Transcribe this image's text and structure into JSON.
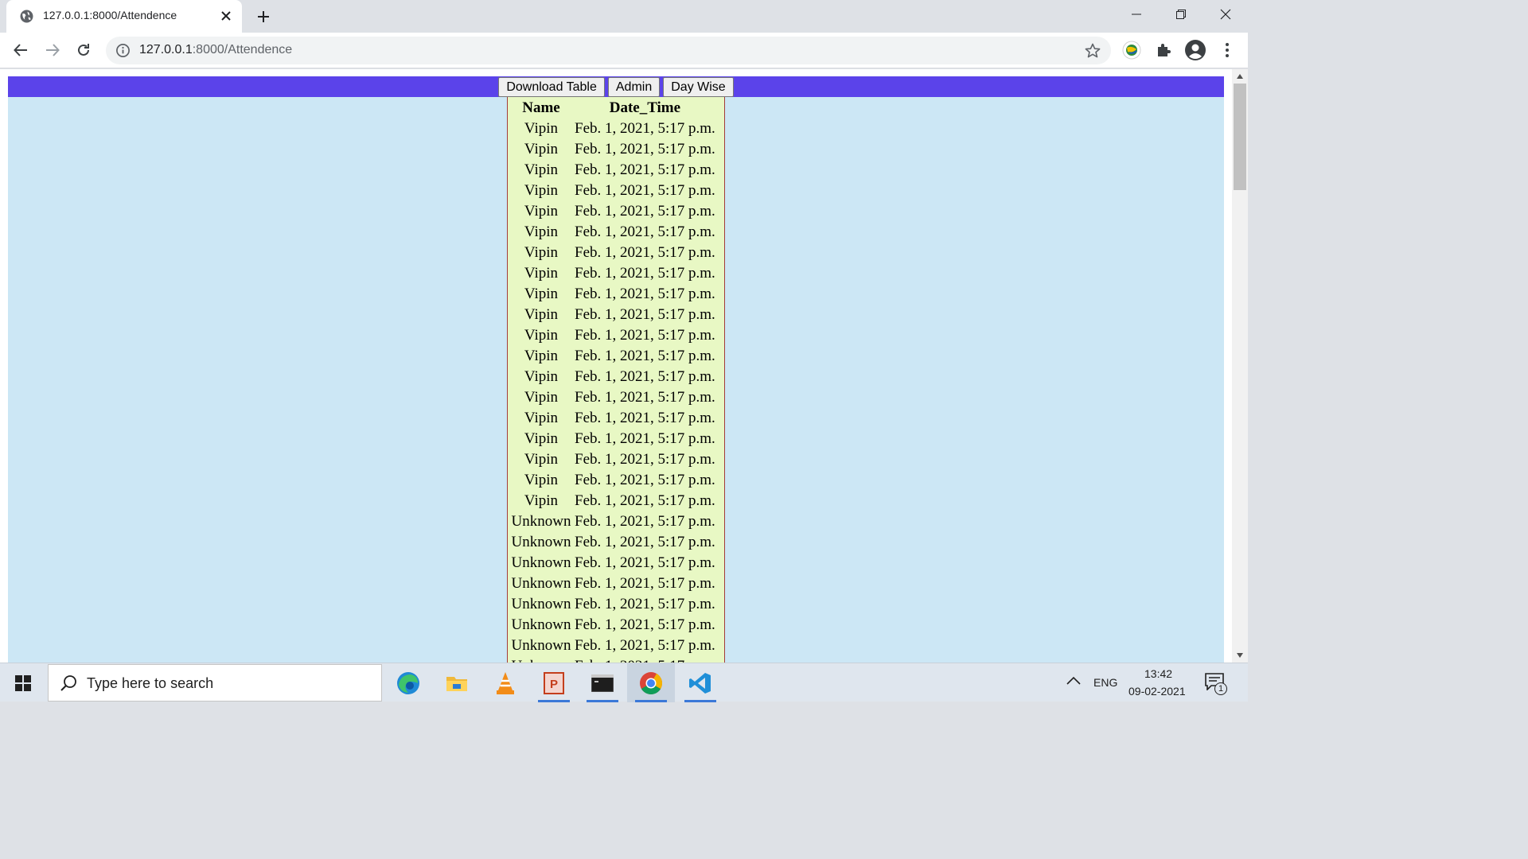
{
  "browser": {
    "tab_title": "127.0.0.1:8000/Attendence",
    "url_host": "127.0.0.1",
    "url_path": ":8000/Attendence"
  },
  "page": {
    "nav_buttons": [
      "Download Table",
      "Admin",
      "Day Wise"
    ],
    "table": {
      "headers": [
        "Name",
        "Date_Time"
      ],
      "rows": [
        [
          "Vipin",
          "Feb. 1, 2021, 5:17 p.m."
        ],
        [
          "Vipin",
          "Feb. 1, 2021, 5:17 p.m."
        ],
        [
          "Vipin",
          "Feb. 1, 2021, 5:17 p.m."
        ],
        [
          "Vipin",
          "Feb. 1, 2021, 5:17 p.m."
        ],
        [
          "Vipin",
          "Feb. 1, 2021, 5:17 p.m."
        ],
        [
          "Vipin",
          "Feb. 1, 2021, 5:17 p.m."
        ],
        [
          "Vipin",
          "Feb. 1, 2021, 5:17 p.m."
        ],
        [
          "Vipin",
          "Feb. 1, 2021, 5:17 p.m."
        ],
        [
          "Vipin",
          "Feb. 1, 2021, 5:17 p.m."
        ],
        [
          "Vipin",
          "Feb. 1, 2021, 5:17 p.m."
        ],
        [
          "Vipin",
          "Feb. 1, 2021, 5:17 p.m."
        ],
        [
          "Vipin",
          "Feb. 1, 2021, 5:17 p.m."
        ],
        [
          "Vipin",
          "Feb. 1, 2021, 5:17 p.m."
        ],
        [
          "Vipin",
          "Feb. 1, 2021, 5:17 p.m."
        ],
        [
          "Vipin",
          "Feb. 1, 2021, 5:17 p.m."
        ],
        [
          "Vipin",
          "Feb. 1, 2021, 5:17 p.m."
        ],
        [
          "Vipin",
          "Feb. 1, 2021, 5:17 p.m."
        ],
        [
          "Vipin",
          "Feb. 1, 2021, 5:17 p.m."
        ],
        [
          "Vipin",
          "Feb. 1, 2021, 5:17 p.m."
        ],
        [
          "Unknown",
          "Feb. 1, 2021, 5:17 p.m."
        ],
        [
          "Unknown",
          "Feb. 1, 2021, 5:17 p.m."
        ],
        [
          "Unknown",
          "Feb. 1, 2021, 5:17 p.m."
        ],
        [
          "Unknown",
          "Feb. 1, 2021, 5:17 p.m."
        ],
        [
          "Unknown",
          "Feb. 1, 2021, 5:17 p.m."
        ],
        [
          "Unknown",
          "Feb. 1, 2021, 5:17 p.m."
        ],
        [
          "Unknown",
          "Feb. 1, 2021, 5:17 p.m."
        ],
        [
          "Unknown",
          "Feb. 1, 2021, 5:17 p.m."
        ]
      ]
    }
  },
  "taskbar": {
    "search_placeholder": "Type here to search",
    "language": "ENG",
    "time": "13:42",
    "date": "09-02-2021",
    "notification_count": "1",
    "apps": [
      "edge-icon",
      "file-explorer-icon",
      "vlc-icon",
      "powerpoint-icon",
      "terminal-icon",
      "chrome-icon",
      "vscode-icon"
    ]
  },
  "colors": {
    "navbar": "#5b43ea",
    "page_background": "#cce7f5",
    "table_background": "#e8f8c4",
    "table_border": "#a33b3b"
  }
}
